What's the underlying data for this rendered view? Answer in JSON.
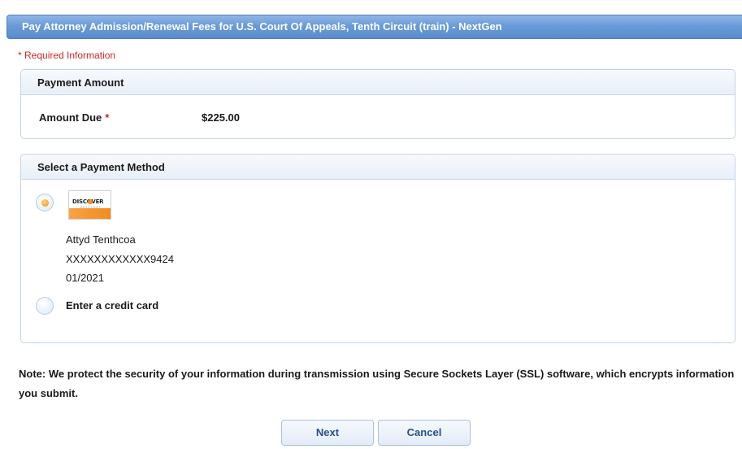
{
  "window": {
    "title": "Pay Attorney Admission/Renewal Fees for U.S. Court Of Appeals, Tenth Circuit (train) - NextGen"
  },
  "form": {
    "required_note": "* Required Information"
  },
  "payment_amount": {
    "header": "Payment Amount",
    "amount_due_label": "Amount Due",
    "required_marker": "*",
    "amount_due_value": "$225.00"
  },
  "payment_method": {
    "header": "Select a Payment Method",
    "saved_card": {
      "selected": true,
      "brand_logo_text": "DISCOVER",
      "holder_name": "Attyd Tenthcoa",
      "masked_number": "XXXXXXXXXXXX9424",
      "expiry": "01/2021"
    },
    "new_card": {
      "selected": false,
      "label": "Enter a credit card"
    }
  },
  "security_note": "Note: We protect the security of your information during transmission using Secure Sockets Layer (SSL) software, which encrypts information you submit.",
  "buttons": {
    "next": "Next",
    "cancel": "Cancel"
  },
  "colors": {
    "title_bar": "#6a9bd8",
    "required_red": "#d0262a",
    "radio_selected": "#f5a623",
    "button_text": "#2a4f86"
  }
}
